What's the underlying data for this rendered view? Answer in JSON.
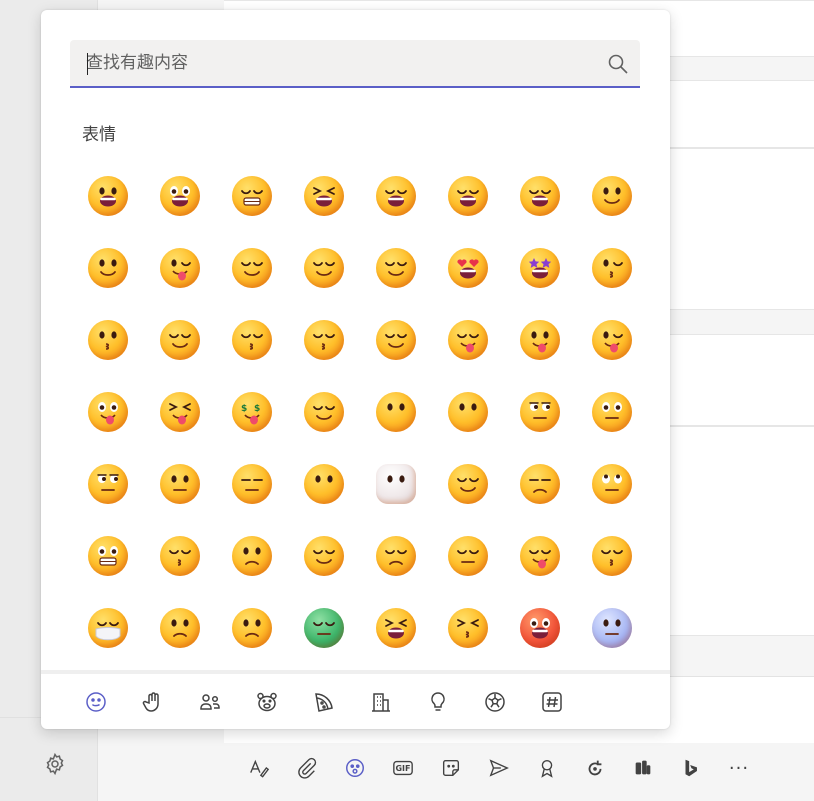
{
  "search": {
    "placeholder": "查找有趣内容"
  },
  "section_title": "表情",
  "accent_color": "#5b5fc7",
  "categories": [
    {
      "name": "smileys-icon",
      "active": true
    },
    {
      "name": "hand-icon",
      "active": false
    },
    {
      "name": "people-icon",
      "active": false
    },
    {
      "name": "animal-icon",
      "active": false
    },
    {
      "name": "food-icon",
      "active": false
    },
    {
      "name": "building-icon",
      "active": false
    },
    {
      "name": "lightbulb-icon",
      "active": false
    },
    {
      "name": "soccer-ball-icon",
      "active": false
    },
    {
      "name": "symbols-icon",
      "active": false
    }
  ],
  "toolbar": [
    {
      "name": "format-icon",
      "active": false
    },
    {
      "name": "attach-icon",
      "active": false
    },
    {
      "name": "emoji-icon",
      "active": true
    },
    {
      "name": "gif-icon",
      "label": "GIF",
      "active": false
    },
    {
      "name": "sticker-icon",
      "active": false
    },
    {
      "name": "send-icon",
      "active": false
    },
    {
      "name": "praise-icon",
      "active": false
    },
    {
      "name": "loop-icon",
      "active": false
    },
    {
      "name": "app-icon",
      "active": false
    },
    {
      "name": "bing-icon",
      "active": false
    },
    {
      "name": "more-icon",
      "label": "···",
      "active": false
    }
  ],
  "emojis": [
    [
      "grinning-face",
      "grinning-face-big-eyes",
      "grinning-face-smiling-eyes",
      "grinning-squinting-face",
      "grinning-face-sweat",
      "rolling-on-floor-laughing",
      "face-tears-of-joy",
      "slightly-smiling-face"
    ],
    [
      "upside-down-face",
      "winking-face",
      "smiling-face-smiling-eyes",
      "smiling-face-halo",
      "smiling-face-hearts",
      "smiling-face-heart-eyes",
      "star-struck",
      "face-blowing-kiss"
    ],
    [
      "kissing-face",
      "smiling-face",
      "kissing-face-closed-eyes",
      "kissing-face-smiling-eyes",
      "smiling-face-tear",
      "face-savoring-food",
      "face-with-tongue",
      "winking-face-tongue"
    ],
    [
      "zany-face",
      "squinting-face-tongue",
      "money-mouth-face",
      "hugging-face",
      "face-open-eyes-hand-over-mouth",
      "face-hand-over-mouth",
      "saluting-face",
      "zipper-mouth-face"
    ],
    [
      "face-raised-eyebrow",
      "neutral-face",
      "expressionless-face",
      "face-without-mouth",
      "face-in-clouds",
      "smirking-face",
      "unamused-face",
      "face-rolling-eyes"
    ],
    [
      "grimacing-face",
      "face-exhaling",
      "worried-face",
      "relieved-face",
      "pensive-face",
      "sleepy-face",
      "drooling-face",
      "sleeping-face"
    ],
    [
      "face-medical-mask",
      "face-thermometer",
      "face-head-bandage",
      "nauseated-face",
      "face-vomiting",
      "sneezing-face",
      "hot-face",
      "cold-face"
    ]
  ]
}
